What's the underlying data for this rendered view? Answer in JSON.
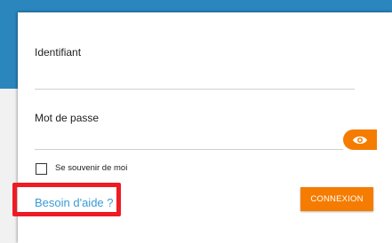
{
  "form": {
    "username_label": "Identifiant",
    "username_value": "",
    "password_label": "Mot de passe",
    "password_value": "",
    "show_password_icon": "eye-icon",
    "remember_me_label": "Se souvenir de moi",
    "remember_me_checked": false,
    "help_link": "Besoin d'aide ?",
    "login_button": "CONNEXION"
  },
  "colors": {
    "brand_blue": "#2b86bd",
    "accent_orange": "#f57c00",
    "link_blue": "#3a9bd5",
    "highlight_red": "#ee1b24"
  }
}
